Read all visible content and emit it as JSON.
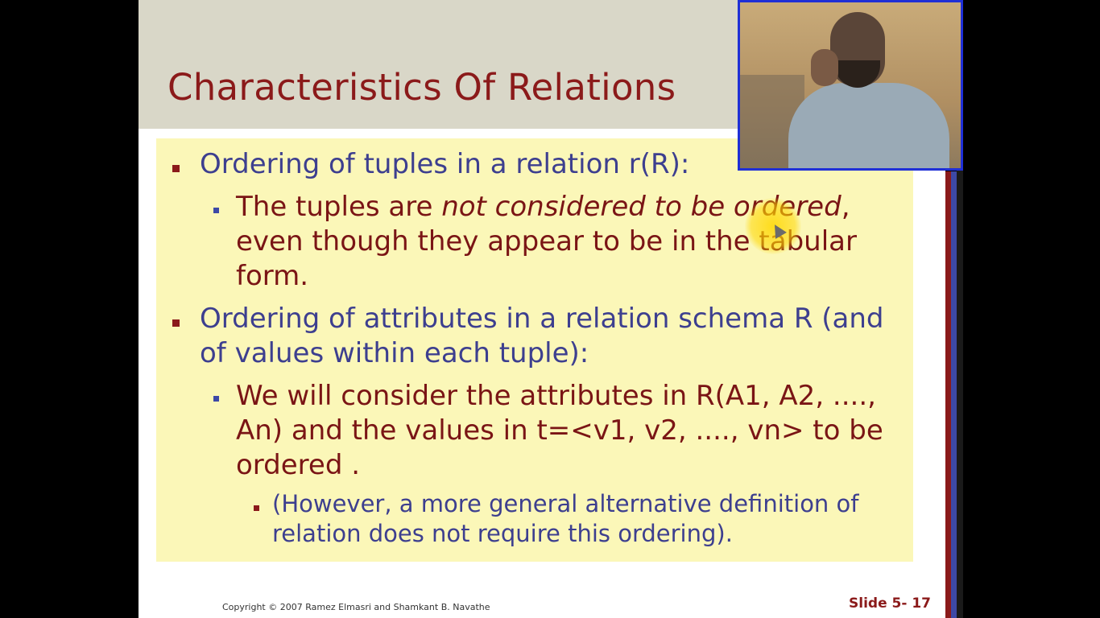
{
  "slide": {
    "title": "Characteristics Of Relations",
    "bullets": [
      {
        "text": "Ordering of tuples in a relation r(R):"
      },
      {
        "pre": "The tuples are ",
        "italic": "not considered to be ordered",
        "post": ",",
        "line2": "even though they appear to be in the tabular",
        "line3": "form."
      },
      {
        "line1": "Ordering of attributes in a relation schema R (and",
        "line2": "of values within each tuple):"
      },
      {
        "line1": "We will consider the attributes in R(A1, A2, ....,",
        "line2": "An) and the values in t=<v1, v2, ...., vn> to be",
        "line3": "ordered ."
      },
      {
        "line1": "(However, a more general alternative definition  of",
        "line2": "relation does not require this ordering)."
      }
    ],
    "footer_copyright": "Copyright © 2007 Ramez Elmasri and Shamkant B. Navathe",
    "slide_number": "Slide 5- 17"
  },
  "colors": {
    "title": "#8b1a1a",
    "level1_text": "#3d3f8f",
    "level2_text": "#7a1515",
    "content_bg": "#fbf7b8",
    "title_band": "#d9d7c8",
    "webcam_border": "#1f2fd6"
  }
}
